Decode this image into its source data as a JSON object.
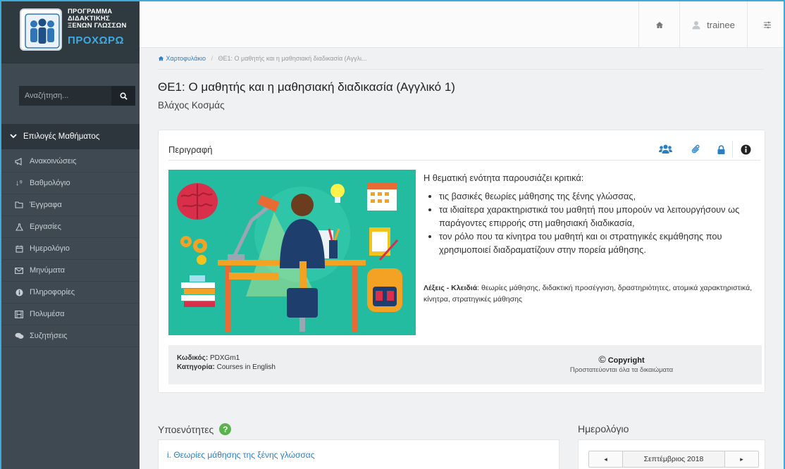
{
  "sidebar": {
    "logo": {
      "line1": "ΠΡΟΓΡΑΜΜΑ",
      "line2": "ΔΙΔΑΚΤΙΚΗΣ",
      "line3": "ΞΕΝΩΝ ΓΛΩΣΣΩΝ",
      "brand": "ΠΡΟΧΩΡΩ"
    },
    "search_placeholder": "Αναζήτηση...",
    "menu_header": "Επιλογές Μαθήματος",
    "items": [
      {
        "label": "Ανακοινώσεις",
        "icon": "megaphone-icon"
      },
      {
        "label": "Βαθμολόγιο",
        "icon": "sort-numeric-icon"
      },
      {
        "label": "Έγγραφα",
        "icon": "folder-icon"
      },
      {
        "label": "Εργασίες",
        "icon": "flask-icon"
      },
      {
        "label": "Ημερολόγιο",
        "icon": "calendar-icon"
      },
      {
        "label": "Μηνύματα",
        "icon": "envelope-icon"
      },
      {
        "label": "Πληροφορίες",
        "icon": "info-icon"
      },
      {
        "label": "Πολυμέσα",
        "icon": "film-icon"
      },
      {
        "label": "Συζητήσεις",
        "icon": "comments-icon"
      }
    ]
  },
  "topbar": {
    "user": "trainee"
  },
  "breadcrumb": {
    "home": "Χαρτοφυλάκιο",
    "sep": "/",
    "current": "ΘΕ1: Ο μαθητής και η μαθησιακή διαδικασία (Αγγλι..."
  },
  "course": {
    "title": "ΘΕ1: Ο μαθητής και η μαθησιακή διαδικασία (Αγγλικό 1)",
    "author": "Βλάχος Κοσμάς"
  },
  "description": {
    "header": "Περιγραφή",
    "intro": "Η θεματική ενότητα παρουσιάζει κριτικά:",
    "bullets": [
      "τις βασικές θεωρίες μάθησης της ξένης γλώσσας,",
      "τα ιδιαίτερα χαρακτηριστικά του μαθητή που μπορούν να λειτουργήσουν ως παράγοντες επιρροής στη μαθησιακή διαδικασία,",
      "τον ρόλο που τα κίνητρα του μαθητή και οι στρατηγικές εκμάθησης που χρησιμοποιεί διαδραματίζουν στην πορεία μάθησης."
    ],
    "keywords_label": "Λέξεις - Κλειδιά",
    "keywords": ": θεωρίες μάθησης, διδακτική προσέγγιση, δραστηριότητες, ατομικά χαρακτηριστικά, κίνητρα, στρατηγικές μάθησης",
    "code_label": "Κωδικός:",
    "code": "PDXGm1",
    "category_label": "Κατηγορία:",
    "category": "Courses in English",
    "copyright": "Copyright",
    "rights": "Προστατεύονται όλα τα δικαιώματα"
  },
  "subsections": {
    "title": "Υποενότητες",
    "help": "?",
    "first": "i. Θεωρίες μάθησης της ξένης γλώσσας"
  },
  "calendar": {
    "title": "Ημερολόγιο",
    "month": "Σεπτέμβριος 2018",
    "prev": "◂",
    "next": "▸"
  },
  "colors": {
    "sidebar": "#3e4951",
    "link": "#2a7fc4",
    "illustration_bg": "#24bca0",
    "accent": "#3fa9d8"
  }
}
